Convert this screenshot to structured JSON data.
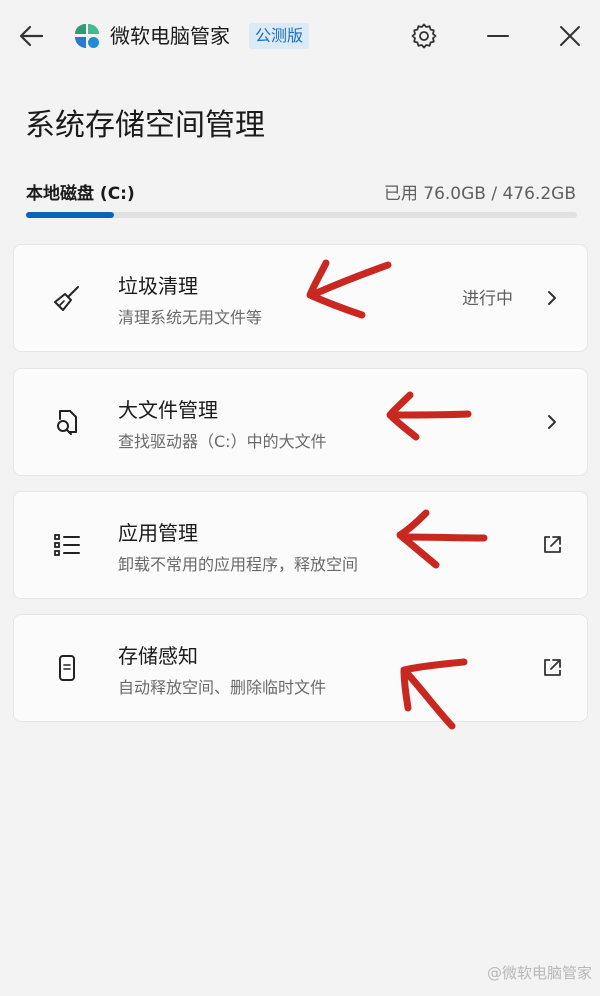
{
  "header": {
    "app_title": "微软电脑管家",
    "badge": "公测版",
    "icons": [
      "arrow-left-icon",
      "app-logo-icon",
      "gear-icon",
      "minimize-icon",
      "close-icon"
    ]
  },
  "page": {
    "title": "系统存储空间管理"
  },
  "disk": {
    "label": "本地磁盘 (C:)",
    "usage_text": "已用 76.0GB / 476.2GB",
    "used_fraction": 0.16
  },
  "cards": [
    {
      "title": "垃圾清理",
      "subtitle": "清理系统无用文件等",
      "status": "进行中",
      "icon": "broom-icon",
      "action_icon": "chevron-right-icon"
    },
    {
      "title": "大文件管理",
      "subtitle": "查找驱动器（C:）中的大文件",
      "icon": "file-search-icon",
      "action_icon": "chevron-right-icon"
    },
    {
      "title": "应用管理",
      "subtitle": "卸载不常用的应用程序，释放空间",
      "icon": "list-icon",
      "action_icon": "open-external-icon"
    },
    {
      "title": "存储感知",
      "subtitle": "自动释放空间、删除临时文件",
      "icon": "phone-storage-icon",
      "action_icon": "open-external-icon"
    }
  ],
  "colors": {
    "accent": "#0b63b8",
    "annotation": "#c8281f",
    "badge_bg": "#dceaf7",
    "badge_text": "#1d6fb8"
  },
  "watermark": "@微软电脑管家"
}
